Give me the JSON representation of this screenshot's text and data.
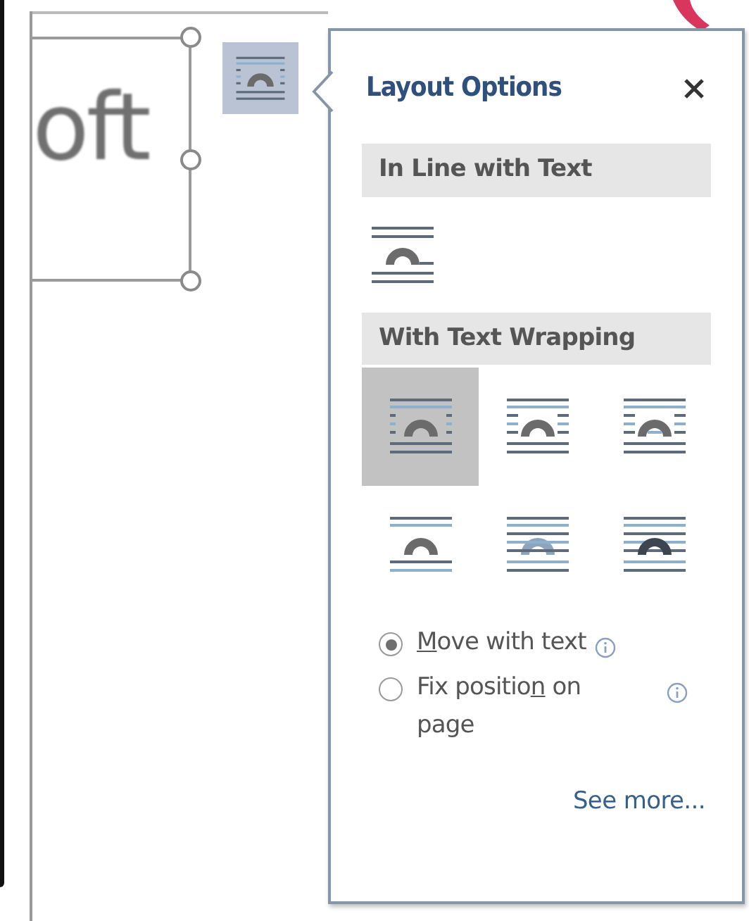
{
  "document": {
    "text_fragment": "oft"
  },
  "panel": {
    "title": "Layout Options",
    "sections": [
      {
        "heading": "In Line with Text",
        "options": [
          {
            "kind": "inline",
            "selected": false
          }
        ]
      },
      {
        "heading": "With Text Wrapping",
        "options": [
          {
            "kind": "square",
            "selected": true
          },
          {
            "kind": "tight",
            "selected": false
          },
          {
            "kind": "through",
            "selected": false
          },
          {
            "kind": "topbottom",
            "selected": false
          },
          {
            "kind": "behind",
            "selected": false
          },
          {
            "kind": "front",
            "selected": false
          }
        ]
      }
    ],
    "position_options": [
      {
        "access_key": "M",
        "text_after": "ove with text",
        "selected": true
      },
      {
        "text_before": "Fix positio",
        "access_key": "n",
        "text_after": " on page",
        "selected": false
      }
    ],
    "see_more": "See more..."
  }
}
